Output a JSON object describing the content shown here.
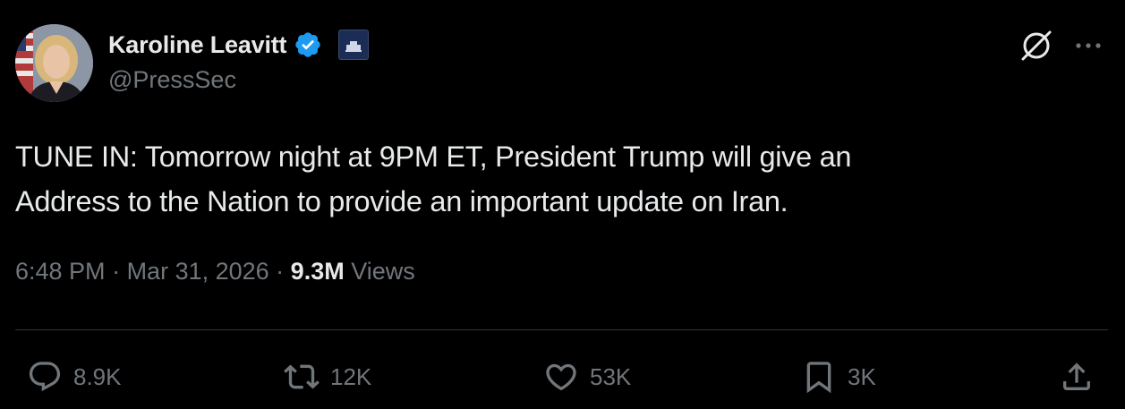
{
  "author": {
    "display_name": "Karoline Leavitt",
    "handle": "@PressSec",
    "verified": true,
    "affiliation_badge": "THE WHITE HOUSE"
  },
  "tweet": {
    "text": "TUNE IN: Tomorrow night at 9PM ET, President Trump will give an\nAddress to the Nation to provide an important update on Iran.",
    "time": "6:48 PM",
    "separator": " · ",
    "date": "Mar 31, 2026",
    "views_count": "9.3M",
    "views_label": " Views"
  },
  "actions": {
    "replies": "8.9K",
    "reposts": "12K",
    "likes": "53K",
    "bookmarks": "3K"
  },
  "icons": {
    "verified": "verified-badge-icon",
    "grok": "grok-icon",
    "more": "more-icon",
    "reply": "reply-icon",
    "repost": "repost-icon",
    "like": "heart-icon",
    "bookmark": "bookmark-icon",
    "share": "share-icon"
  },
  "colors": {
    "background": "#000000",
    "primary_text": "#e7e9ea",
    "secondary_text": "#71767b",
    "verified": "#1d9bf0",
    "divider": "#2f3336"
  }
}
